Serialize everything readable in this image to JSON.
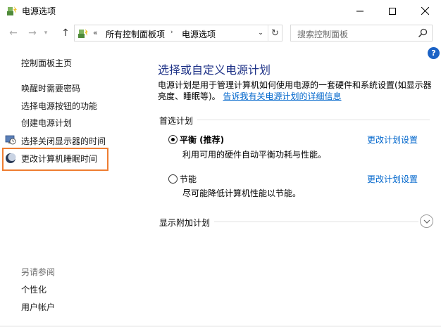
{
  "window": {
    "title": "电源选项",
    "controls": {
      "minimize": "minimize",
      "maximize": "maximize",
      "close": "close"
    }
  },
  "address_bar": {
    "overflow": "«",
    "breadcrumbs": [
      "所有控制面板项",
      "电源选项"
    ],
    "search_placeholder": "搜索控制面板"
  },
  "sidebar": {
    "items": [
      {
        "label": "控制面板主页",
        "icon": null
      },
      {
        "label": "唤醒时需要密码",
        "icon": null
      },
      {
        "label": "选择电源按钮的功能",
        "icon": null
      },
      {
        "label": "创建电源计划",
        "icon": null
      },
      {
        "label": "选择关闭显示器的时间",
        "icon": "monitor-clock-icon"
      },
      {
        "label": "更改计算机睡眠时间",
        "icon": "moon-icon",
        "highlighted": true
      }
    ],
    "see_also": {
      "title": "另请参阅",
      "links": [
        "个性化",
        "用户帐户"
      ]
    }
  },
  "main": {
    "title": "选择或自定义电源计划",
    "description": "电源计划是用于管理计算机如何使用电源的一套硬件和系统设置(如显示器亮度、睡眠等)。",
    "description_link": "告诉我有关电源计划的详细信息",
    "preferred_group_label": "首选计划",
    "plans": [
      {
        "name": "平衡 (推荐)",
        "desc": "利用可用的硬件自动平衡功耗与性能。",
        "link": "更改计划设置",
        "selected": true
      },
      {
        "name": "节能",
        "desc": "尽可能降低计算机性能以节能。",
        "link": "更改计划设置",
        "selected": false
      }
    ],
    "show_more_label": "显示附加计划"
  },
  "colors": {
    "title_blue": "#1e3287",
    "link_blue": "#0066cc",
    "highlight_orange": "#ee7d31",
    "help_blue": "#1b62c5"
  }
}
